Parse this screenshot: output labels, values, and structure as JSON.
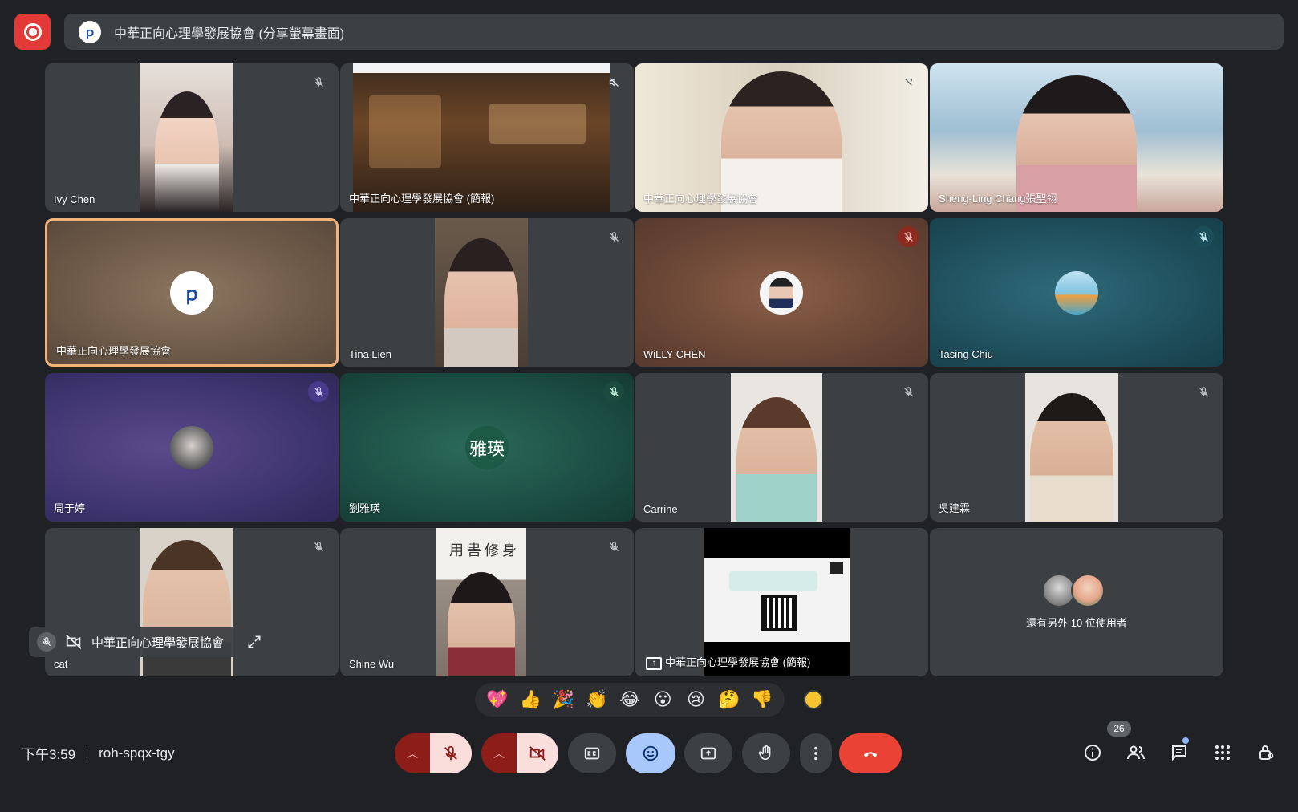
{
  "top_bar": {
    "record_icon": "record-icon",
    "share_title": "中華正向心理學發展協會 (分享螢幕畫面)"
  },
  "tiles": [
    {
      "name": "Ivy Chen"
    },
    {
      "name": "中華正向心理學發展協會 (簡報)"
    },
    {
      "name": "中華正向心理學發展協會"
    },
    {
      "name": "Sheng-Ling Chang張聖翎"
    },
    {
      "name": "中華正向心理學發展協會"
    },
    {
      "name": "Tina Lien"
    },
    {
      "name": "WiLLY CHEN"
    },
    {
      "name": "Tasing Chiu"
    },
    {
      "name": "周于婷"
    },
    {
      "name": "劉雅瑛",
      "initials": "雅瑛"
    },
    {
      "name": "Carrine"
    },
    {
      "name": "吳建霖"
    },
    {
      "name": "cat"
    },
    {
      "name": "Shine Wu"
    },
    {
      "name": "中華正向心理學發展協會 (簡報)"
    }
  ],
  "self_view": {
    "label": "中華正向心理學發展協會"
  },
  "more_users": {
    "label": "還有另外 10 位使用者"
  },
  "reactions": [
    "💖",
    "👍",
    "🎉",
    "👏",
    "😂",
    "😮",
    "😢",
    "🤔",
    "👎"
  ],
  "bottom": {
    "time": "下午3:59",
    "meeting_code": "roh-spqx-tgy",
    "participant_count": "26"
  },
  "colors": {
    "hangup": "#ea4335",
    "record": "#e33a37",
    "active_speaker_border": "#f3b277",
    "emoji_active": "#a8c7fa"
  }
}
